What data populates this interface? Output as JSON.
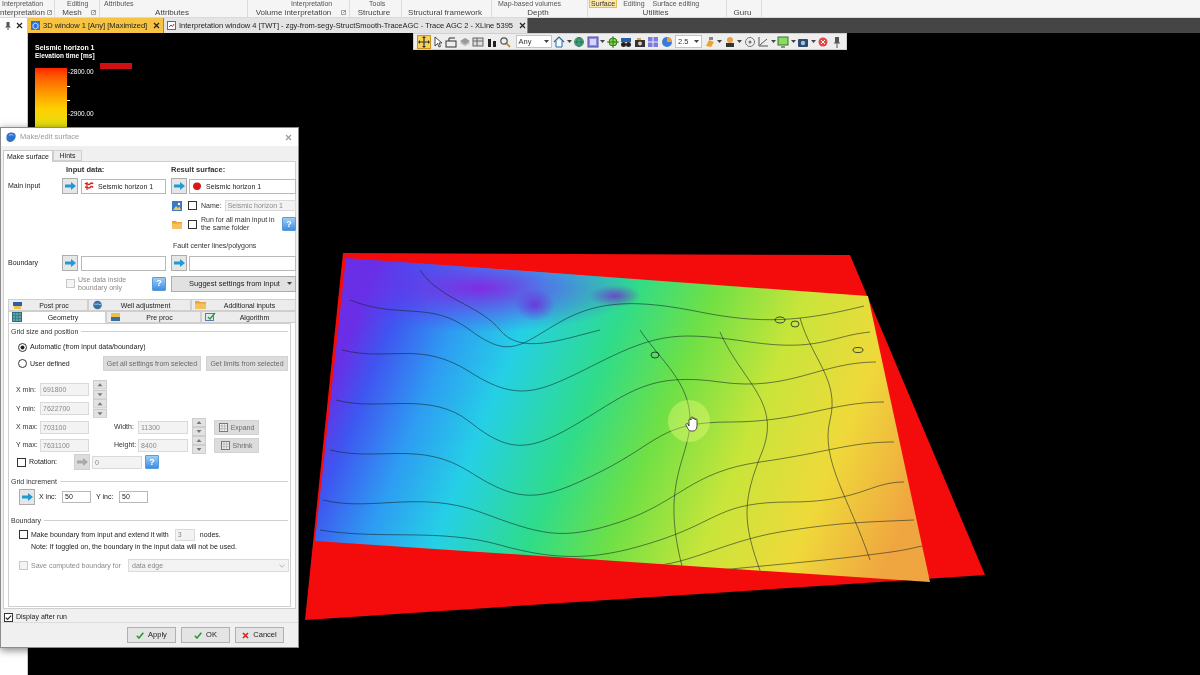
{
  "ribbon": {
    "groups": [
      {
        "label": "nterpretation",
        "commands": [
          {
            "label": "Interpretation",
            "selected": false
          }
        ]
      },
      {
        "label": "Mesh",
        "commands": [
          {
            "label": "Editing",
            "selected": false
          }
        ]
      },
      {
        "label": "Attributes",
        "commands": [
          {
            "label": "Attributes",
            "selected": false
          }
        ]
      },
      {
        "label": "Volume interpretation",
        "commands": [
          {
            "label": "Interpretation",
            "selected": false
          }
        ]
      },
      {
        "label": "Structure",
        "commands": [
          {
            "label": "Tools",
            "selected": false
          }
        ]
      },
      {
        "label": "Structural framework"
      },
      {
        "label": "Depth",
        "commands": [
          {
            "label": "Map-based volumes",
            "selected": false
          }
        ]
      },
      {
        "label": "Utilities",
        "commands": [
          {
            "label": "Surface",
            "selected": true
          },
          {
            "label": "Editing",
            "selected": false
          },
          {
            "label": "Surface editing",
            "selected": false
          }
        ]
      },
      {
        "label": "Guru"
      }
    ]
  },
  "window_tabs": [
    {
      "label": "3D window 1 [Any] [Maximized]",
      "selected": true
    },
    {
      "label": "Interpretation window 4 [TWT] - zgy-from-segy-StructSmooth-TraceAGC - Trace AGC 2 - XLine 5395",
      "selected": false
    }
  ],
  "toolbar": {
    "tools": [
      {
        "selected": true
      },
      {
        "selected": false
      },
      {
        "selected": false
      },
      {
        "selected": false
      },
      {
        "selected": false
      },
      {
        "selected": false
      },
      {
        "selected": false
      }
    ],
    "mode": "Any",
    "scale": "2.5"
  },
  "legend": {
    "title": "Seismic horizon 1",
    "subtitle": "Elevation time [ms]",
    "ticks": [
      "-2800.00",
      "-2900.00"
    ]
  },
  "dialog": {
    "title": "Make/edit surface",
    "tabs": [
      {
        "label": "Make surface",
        "selected": true
      },
      {
        "label": "Hints",
        "selected": false
      }
    ],
    "input_header": "Input data:",
    "result_header": "Result surface:",
    "main_input": {
      "label": "Main input",
      "input": "Seismic horizon 1",
      "result": "Seismic horizon 1"
    },
    "name_option": {
      "label": "Name:",
      "checked": false,
      "value": "Seismic horizon 1"
    },
    "run_all_option": {
      "label": "Run for all main input in the same folder",
      "checked": false,
      "help": "?"
    },
    "fault_header": "Fault center lines/polygons",
    "boundary": {
      "label": "Boundary"
    },
    "use_data_option": {
      "label": "Use data inside boundary only",
      "checked": false,
      "disabled": true,
      "help": "?"
    },
    "suggest_button": "Suggest settings from input",
    "section_tab_rows": [
      {
        "tabs": [
          {
            "label": "Post proc",
            "selected": false
          },
          {
            "label": "Well adjustment",
            "selected": false
          },
          {
            "label": "Additional inputs",
            "selected": false
          }
        ]
      },
      {
        "tabs": [
          {
            "label": "Geometry",
            "selected": true
          },
          {
            "label": "Pre proc",
            "selected": false
          },
          {
            "label": "Algorithm",
            "selected": false
          }
        ]
      }
    ],
    "grid_group": "Grid size and position",
    "grid_modes": [
      {
        "label": "Automatic (from input data/boundary)",
        "selected": true
      },
      {
        "label": "User defined",
        "selected": false
      }
    ],
    "grid_buttons": [
      "Get all settings from selected",
      "Get limits from selected"
    ],
    "extent_fields": [
      {
        "label": "X min:",
        "value": "691800",
        "disabled": true
      },
      {
        "label": "Y min:",
        "value": "7622700",
        "disabled": true
      },
      {
        "label": "X max:",
        "value": "703100",
        "disabled": true
      },
      {
        "label": "Y max:",
        "value": "7631100",
        "disabled": true
      }
    ],
    "size_fields": [
      {
        "label": "Width:",
        "value": "11300",
        "disabled": true
      },
      {
        "label": "Height:",
        "value": "8400",
        "disabled": true
      }
    ],
    "size_buttons": [
      "Expand",
      "Shrink"
    ],
    "rotation": {
      "label": "Rotation:",
      "checked": false,
      "value": "0",
      "help": "?"
    },
    "increment_group": "Grid increment",
    "increments": [
      {
        "label": "X inc:",
        "value": "50"
      },
      {
        "label": "Y inc:",
        "value": "50"
      }
    ],
    "boundary_group": "Boundary",
    "extend_option": {
      "label": "Make boundary from input and extend it with",
      "checked": false,
      "value": "3",
      "unit": "nodes."
    },
    "note": "Note: If toggled on, the boundary in the input data will not be used.",
    "save_option": {
      "label": "Save computed boundary for",
      "checked": false,
      "disabled": true,
      "value": "data edge"
    },
    "display_option": {
      "label": "Display after run",
      "checked": true
    },
    "buttons": [
      {
        "label": "Apply",
        "kind": "confirm"
      },
      {
        "label": "OK",
        "kind": "confirm"
      },
      {
        "label": "Cancel",
        "kind": "cancel"
      }
    ]
  }
}
